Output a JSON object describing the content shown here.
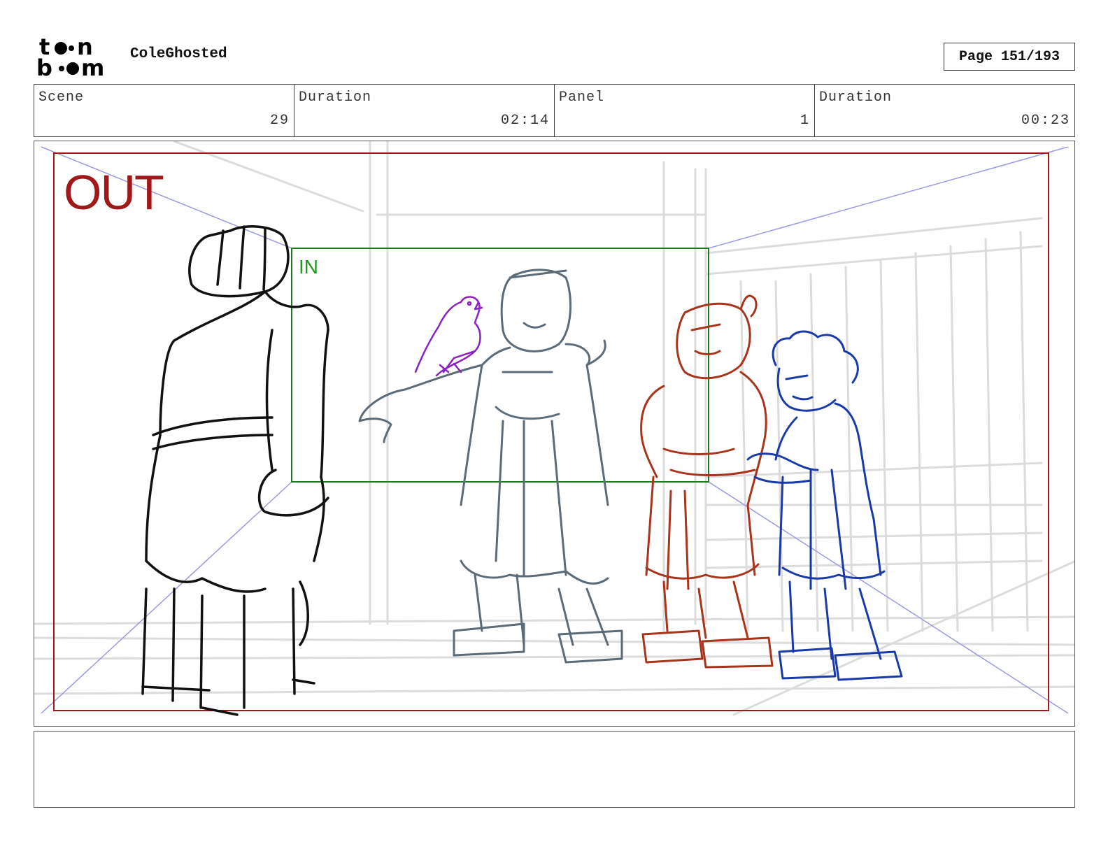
{
  "header": {
    "logo_text": "toon boom",
    "project_title": "ColeGhosted",
    "page_label": "Page 151/193"
  },
  "info": {
    "scene_label": "Scene",
    "scene_value": "29",
    "scene_duration_label": "Duration",
    "scene_duration_value": "02:14",
    "panel_label": "Panel",
    "panel_value": "1",
    "panel_duration_label": "Duration",
    "panel_duration_value": "00:23"
  },
  "panel": {
    "out_label": "OUT",
    "in_label": "IN"
  },
  "colors": {
    "out_frame": "#a01818",
    "in_frame": "#1e7a1e",
    "perspective": "#9b9be0",
    "character_black": "#111111",
    "character_grey": "#5c6b78",
    "character_red": "#a8341c",
    "character_blue": "#1a3aa8",
    "bird_purple": "#8a22c0",
    "background_lines": "#d8d8d8"
  },
  "notes": {
    "text": ""
  }
}
